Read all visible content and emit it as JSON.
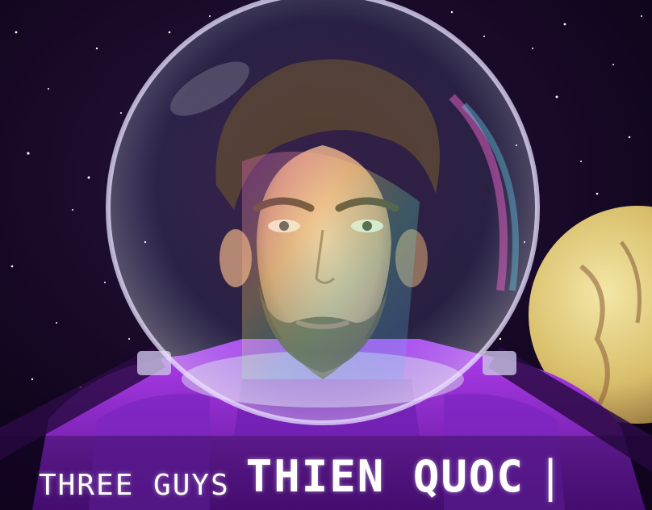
{
  "poster": {
    "subject": "astronaut-portrait",
    "caption": {
      "brand": "THREE GUYS",
      "title": "THIEN QUOC",
      "mark": "|"
    },
    "colors": {
      "background": "#120620",
      "suit": "#9a2ddc",
      "helmet_rim": "#e8e0ff",
      "planet": "#e2d28a"
    }
  }
}
